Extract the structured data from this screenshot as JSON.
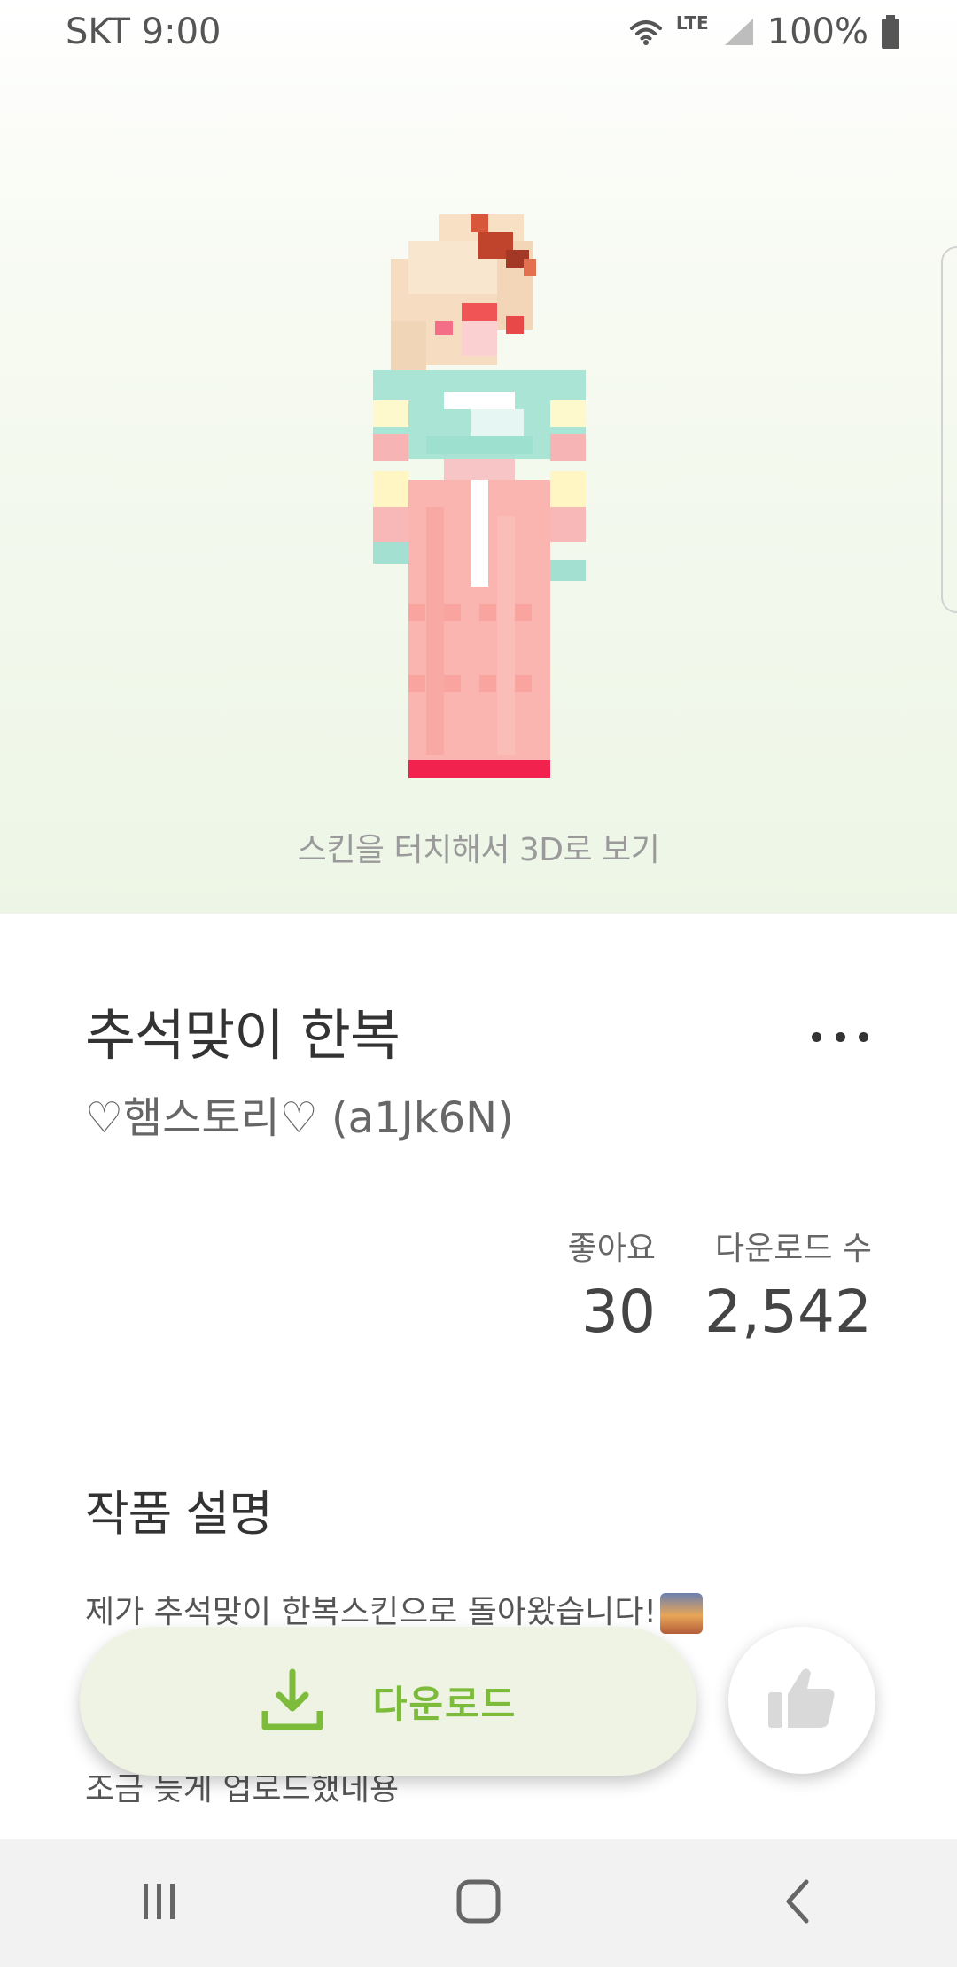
{
  "status_bar": {
    "carrier_time": "SKT 9:00",
    "network": "LTE",
    "battery": "100%",
    "icons": [
      "wifi-icon",
      "signal-icon",
      "battery-icon"
    ]
  },
  "preview": {
    "caption": "스킨을 터치해서 3D로 보기",
    "skin_icon": "pixel-skin-figure"
  },
  "skin": {
    "title": "추석맞이 한복",
    "author": "♡햄스토리♡ (a1Jk6N)",
    "more_icon": "more-dots-icon"
  },
  "stats": {
    "likes_label": "좋아요",
    "likes_value": "30",
    "downloads_label": "다운로드 수",
    "downloads_value": "2,542"
  },
  "description": {
    "heading": "작품 설명",
    "line1": "제가 추석맞이 한복스킨으로 돌아왔습니다!",
    "line2": "조금 늦게 업로드했네용"
  },
  "actions": {
    "download_label": "다운로드",
    "download_icon": "download-icon",
    "like_icon": "thumbs-up-icon"
  },
  "navigation": {
    "icons": [
      "recents-icon",
      "home-icon",
      "back-icon"
    ]
  },
  "colors": {
    "accent": "#7dbb3a",
    "download_bg": "#eef3e4"
  }
}
